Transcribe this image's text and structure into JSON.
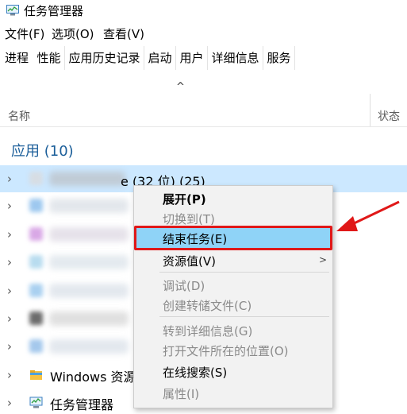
{
  "window": {
    "title": "任务管理器"
  },
  "menubar": {
    "items": [
      "文件(F)",
      "选项(O)",
      "查看(V)"
    ]
  },
  "tabs": [
    {
      "label": "进程",
      "active": true
    },
    {
      "label": "性能",
      "active": false
    },
    {
      "label": "应用历史记录",
      "active": false
    },
    {
      "label": "启动",
      "active": false
    },
    {
      "label": "用户",
      "active": false
    },
    {
      "label": "详细信息",
      "active": false
    },
    {
      "label": "服务",
      "active": false
    }
  ],
  "table": {
    "sort_indicator": "^",
    "columns": {
      "name": "名称",
      "status": "状态"
    },
    "group": {
      "title": "应用 (10)"
    },
    "rows": [
      {
        "label_visible": "e (32 位) (25)",
        "selected": true,
        "icon": "app-icon-blurred"
      },
      {
        "label_visible": "",
        "selected": false,
        "icon": "app-icon-blurred"
      },
      {
        "label_visible": "",
        "selected": false,
        "icon": "app-icon-blurred"
      },
      {
        "label_visible": "",
        "selected": false,
        "icon": "app-icon-blurred"
      },
      {
        "label_visible": "",
        "selected": false,
        "icon": "app-icon-blurred"
      },
      {
        "label_visible": "",
        "selected": false,
        "icon": "app-icon-blurred"
      },
      {
        "label_visible": "",
        "selected": false,
        "icon": "app-icon-blurred"
      },
      {
        "label_visible": "Windows 资源管",
        "selected": false,
        "icon": "folder-icon"
      },
      {
        "label_visible": "任务管理器",
        "selected": false,
        "icon": "task-manager-icon"
      }
    ]
  },
  "context_menu": {
    "items": [
      {
        "label": "展开(P)",
        "style": "bold"
      },
      {
        "label": "切换到(T)",
        "style": "disabled"
      },
      {
        "label": "结束任务(E)",
        "style": "highlighted"
      },
      {
        "label": "资源值(V)",
        "style": "normal",
        "submenu": true
      },
      {
        "label": "调试(D)",
        "style": "disabled"
      },
      {
        "label": "创建转储文件(C)",
        "style": "disabled"
      },
      {
        "label": "转到详细信息(G)",
        "style": "disabled"
      },
      {
        "label": "打开文件所在的位置(O)",
        "style": "disabled"
      },
      {
        "label": "在线搜索(S)",
        "style": "normal"
      },
      {
        "label": "属性(I)",
        "style": "disabled"
      }
    ],
    "submenu_arrow": ">"
  },
  "colors": {
    "accent_blue": "#1c5f9a",
    "selection": "#cce8ff",
    "menu_highlight": "#8fd3f7",
    "annotation_red": "#e01818"
  }
}
